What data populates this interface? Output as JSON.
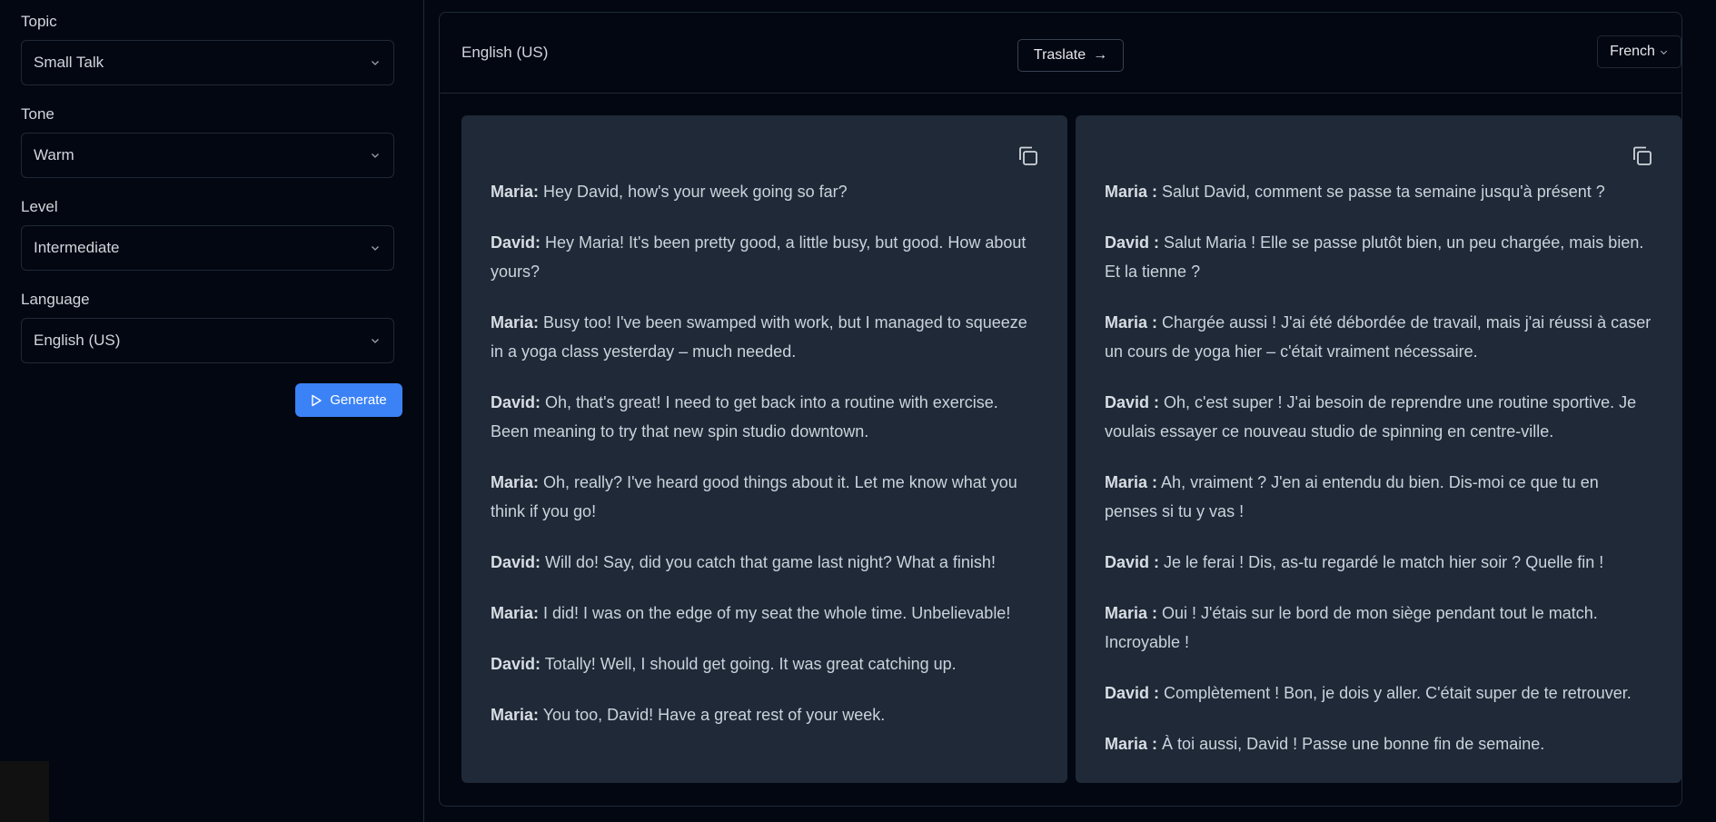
{
  "sidebar": {
    "fields": [
      {
        "label": "Topic",
        "value": "Small Talk"
      },
      {
        "label": "Tone",
        "value": "Warm"
      },
      {
        "label": "Level",
        "value": "Intermediate"
      },
      {
        "label": "Language",
        "value": "English (US)"
      }
    ],
    "generate_label": "Generate"
  },
  "header": {
    "source_language": "English (US)",
    "translate_label": "Traslate",
    "translate_arrow": "→",
    "target_language": "French"
  },
  "source": [
    {
      "speaker": "Maria:",
      "text": "Hey David, how's your week going so far?"
    },
    {
      "speaker": "David:",
      "text": "Hey Maria! It's been pretty good, a little busy, but good. How about yours?"
    },
    {
      "speaker": "Maria:",
      "text": "Busy too! I've been swamped with work, but I managed to squeeze in a yoga class yesterday – much needed."
    },
    {
      "speaker": "David:",
      "text": "Oh, that's great! I need to get back into a routine with exercise. Been meaning to try that new spin studio downtown."
    },
    {
      "speaker": "Maria:",
      "text": "Oh, really? I've heard good things about it. Let me know what you think if you go!"
    },
    {
      "speaker": "David:",
      "text": "Will do! Say, did you catch that game last night? What a finish!"
    },
    {
      "speaker": "Maria:",
      "text": "I did! I was on the edge of my seat the whole time. Unbelievable!"
    },
    {
      "speaker": "David:",
      "text": "Totally! Well, I should get going. It was great catching up."
    },
    {
      "speaker": "Maria:",
      "text": "You too, David! Have a great rest of your week."
    }
  ],
  "translation": [
    {
      "speaker": "Maria :",
      "text": "Salut David, comment se passe ta semaine jusqu'à présent ?"
    },
    {
      "speaker": "David :",
      "text": "Salut Maria ! Elle se passe plutôt bien, un peu chargée, mais bien. Et la tienne ?"
    },
    {
      "speaker": "Maria :",
      "text": "Chargée aussi ! J'ai été débordée de travail, mais j'ai réussi à caser un cours de yoga hier – c'était vraiment nécessaire."
    },
    {
      "speaker": "David :",
      "text": "Oh, c'est super ! J'ai besoin de reprendre une routine sportive. Je voulais essayer ce nouveau studio de spinning en centre-ville."
    },
    {
      "speaker": "Maria :",
      "text": "Ah, vraiment ? J'en ai entendu du bien. Dis-moi ce que tu en penses si tu y vas !"
    },
    {
      "speaker": "David :",
      "text": "Je le ferai ! Dis, as-tu regardé le match hier soir ? Quelle fin !"
    },
    {
      "speaker": "Maria :",
      "text": "Oui ! J'étais sur le bord de mon siège pendant tout le match. Incroyable !"
    },
    {
      "speaker": "David :",
      "text": "Complètement ! Bon, je dois y aller. C'était super de te retrouver."
    },
    {
      "speaker": "Maria :",
      "text": "À toi aussi, David ! Passe une bonne fin de semaine."
    }
  ],
  "icons": {
    "chevron": "chevron-down-icon",
    "play": "play-icon",
    "copy": "copy-icon"
  },
  "colors": {
    "accent": "#3b82f6",
    "background": "#030712",
    "card": "#1f2937"
  }
}
